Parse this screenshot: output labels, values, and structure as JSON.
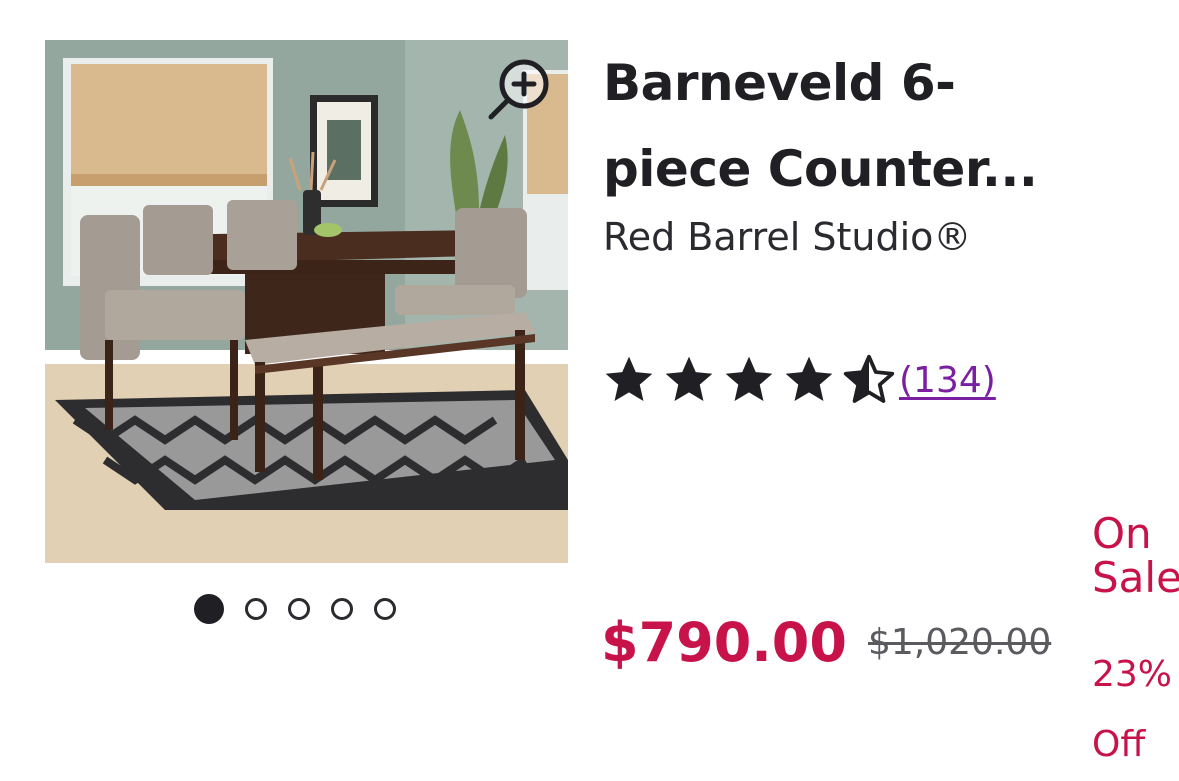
{
  "product": {
    "title": "Barneveld 6-piece Counter...",
    "brand": "Red Barrel Studio®",
    "rating": 4.5,
    "rating_max": 5,
    "review_count": "(134)",
    "price": "$790.00",
    "original_price": "$1,020.00",
    "sale_label": "On Sale",
    "discount": "23% Off"
  },
  "image": {
    "alt": "Counter height dining table with upholstered chairs and bench on a patterned rug",
    "zoom_icon": "zoom-in-icon"
  },
  "carousel": {
    "total": 5,
    "active_index": 0
  },
  "colors": {
    "price": "#c8134a",
    "link": "#7b1fa2",
    "text": "#1f1f24"
  }
}
